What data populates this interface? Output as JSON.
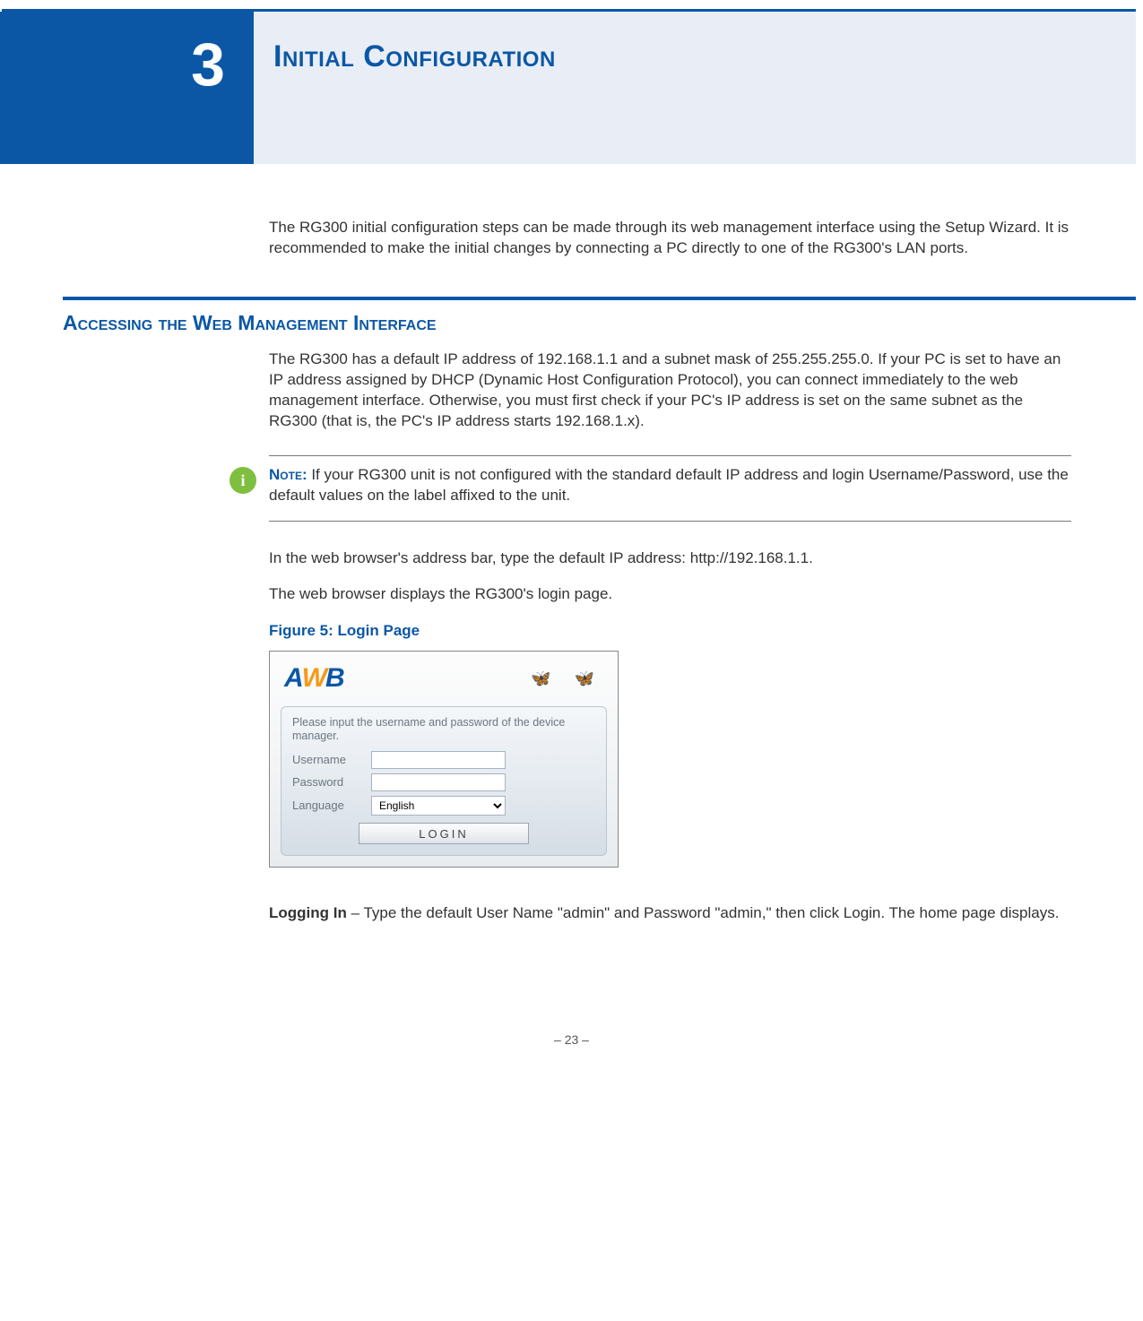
{
  "chapter": {
    "number": "3",
    "title": "Initial Configuration"
  },
  "intro": "The RG300 initial configuration steps can be made through its web management interface using the Setup Wizard. It is recommended to make the initial changes by connecting a PC directly to one of the RG300's LAN ports.",
  "section1": {
    "heading": "Accessing the Web Management Interface",
    "p1": "The RG300 has a default IP address of 192.168.1.1 and a subnet mask of 255.255.255.0. If your PC is set to have an IP address assigned by DHCP (Dynamic Host Configuration Protocol), you can connect immediately to the web management interface. Otherwise, you must first check if your PC's IP address is set on the same subnet as the RG300 (that is, the PC's IP address starts 192.168.1.x)."
  },
  "note": {
    "label": "Note:",
    "text": " If your RG300 unit is not configured with the standard default IP address and login Username/Password, use the default values on the label affixed to the unit."
  },
  "p_addr": "In the web browser's address bar, type the default IP address: http://192.168.1.1.",
  "p_login_disp": "The web browser displays the RG300's login page.",
  "figure": {
    "caption": "Figure 5:  Login Page"
  },
  "login_panel": {
    "instruction": "Please input the username and password of the device manager.",
    "username_label": "Username",
    "password_label": "Password",
    "language_label": "Language",
    "language_value": "English",
    "button": "LOGIN"
  },
  "logging_in": {
    "label": "Logging In",
    "text": " – Type the default User Name \"admin\" and Password \"admin,\" then click Login. The home page displays."
  },
  "page_number": "–  23  –"
}
